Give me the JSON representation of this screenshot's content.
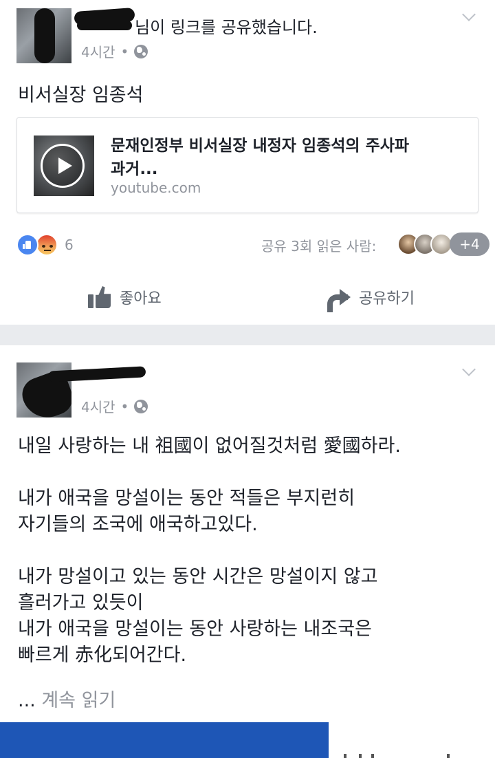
{
  "post1": {
    "author_suffix": "님이 링크를 공유했습니다.",
    "time": "4시간",
    "separator": "•",
    "text": "비서실장 임종석",
    "link": {
      "title_line1": "문재인정부 비서실장 내정자 임종석의 주사파",
      "title_line2": "과거...",
      "domain": "youtube.com"
    },
    "reaction_count": "6",
    "share_stat": "공유 3회 읽은 사람:",
    "seen_more": "+4",
    "like_label": "좋아요",
    "share_label": "공유하기"
  },
  "post2": {
    "time": "4시간",
    "separator": "•",
    "lines": [
      "내일 사랑하는 내 祖國이 없어질것처럼 愛國하라.",
      "",
      "내가 애국을 망설이는 동안 적들은 부지런히",
      "자기들의 조국에 애국하고있다.",
      "",
      "내가 망설이고 있는 동안 시간은 망설이지 않고",
      "흘러가고 있듯이",
      "내가 애국을 망설이는 동안 사랑하는 내조국은",
      "빠르게 赤化되어간다."
    ],
    "ellipsis": "...",
    "see_more": "계속 읽기"
  },
  "colors": {
    "text": "#1d2129",
    "meta": "#90949c",
    "like_blue": "#4a86f0",
    "bottom_bar": "#1e56b6",
    "background": "#e9ebee"
  },
  "icons": [
    "globe-icon",
    "chevron-down-icon",
    "like-reaction-icon",
    "angry-reaction-icon",
    "thumbs-up-icon",
    "share-arrow-icon",
    "play-icon"
  ]
}
